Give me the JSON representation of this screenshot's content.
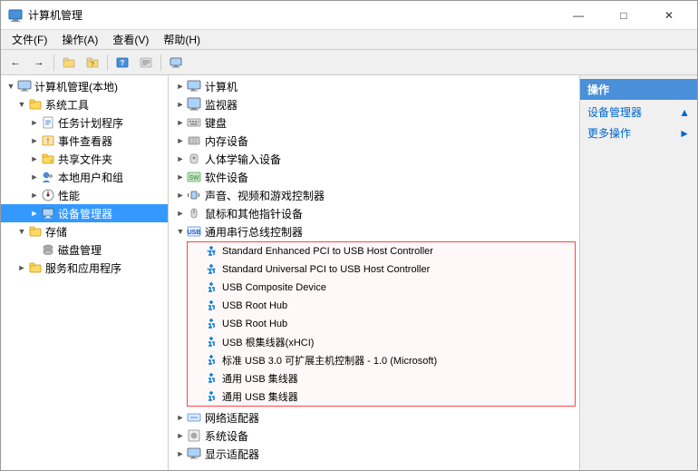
{
  "window": {
    "title": "计算机管理",
    "controls": {
      "minimize": "—",
      "maximize": "□",
      "close": "✕"
    }
  },
  "menubar": {
    "items": [
      "文件(F)",
      "操作(A)",
      "查看(V)",
      "帮助(H)"
    ]
  },
  "actions_panel": {
    "title": "操作",
    "items": [
      {
        "label": "设备管理器",
        "has_arrow": true
      },
      {
        "label": "更多操作",
        "has_arrow": true
      }
    ]
  },
  "tree": {
    "root_label": "计算机管理(本地)",
    "items": [
      {
        "label": "系统工具",
        "level": 1,
        "expanded": true,
        "type": "folder"
      },
      {
        "label": "任务计划程序",
        "level": 2,
        "type": "task"
      },
      {
        "label": "事件查看器",
        "level": 2,
        "type": "event"
      },
      {
        "label": "共享文件夹",
        "level": 2,
        "type": "folder"
      },
      {
        "label": "本地用户和组",
        "level": 2,
        "type": "users"
      },
      {
        "label": "性能",
        "level": 2,
        "type": "perf"
      },
      {
        "label": "设备管理器",
        "level": 2,
        "type": "device",
        "selected": true
      },
      {
        "label": "存储",
        "level": 1,
        "expanded": true,
        "type": "storage"
      },
      {
        "label": "磁盘管理",
        "level": 2,
        "type": "disk"
      },
      {
        "label": "服务和应用程序",
        "level": 1,
        "type": "services"
      }
    ]
  },
  "devices": {
    "items": [
      {
        "label": "计算机",
        "level": 0,
        "expanded": false,
        "type": "computer"
      },
      {
        "label": "监视器",
        "level": 0,
        "expanded": false,
        "type": "monitor"
      },
      {
        "label": "键盘",
        "level": 0,
        "expanded": false,
        "type": "keyboard"
      },
      {
        "label": "内存设备",
        "level": 0,
        "expanded": false,
        "type": "memory"
      },
      {
        "label": "人体学输入设备",
        "level": 0,
        "expanded": false,
        "type": "hid"
      },
      {
        "label": "软件设备",
        "level": 0,
        "expanded": false,
        "type": "software"
      },
      {
        "label": "声音、视频和游戏控制器",
        "level": 0,
        "expanded": false,
        "type": "audio"
      },
      {
        "label": "鼠标和其他指针设备",
        "level": 0,
        "expanded": false,
        "type": "mouse"
      },
      {
        "label": "通用串行总线控制器",
        "level": 0,
        "expanded": true,
        "type": "usb"
      },
      {
        "label": "Standard Enhanced PCI to USB Host Controller",
        "level": 1,
        "type": "usbdev",
        "highlighted": true
      },
      {
        "label": "Standard Universal PCI to USB Host Controller",
        "level": 1,
        "type": "usbdev",
        "highlighted": true
      },
      {
        "label": "USB Composite Device",
        "level": 1,
        "type": "usbdev",
        "highlighted": true
      },
      {
        "label": "USB Root Hub",
        "level": 1,
        "type": "usbdev",
        "highlighted": true
      },
      {
        "label": "USB Root Hub",
        "level": 1,
        "type": "usbdev",
        "highlighted": true
      },
      {
        "label": "USB 根集线器(xHCI)",
        "level": 1,
        "type": "usbdev",
        "highlighted": true
      },
      {
        "label": "标准 USB 3.0 可扩展主机控制器 - 1.0 (Microsoft)",
        "level": 1,
        "type": "usbdev",
        "highlighted": true
      },
      {
        "label": "通用 USB 集线器",
        "level": 1,
        "type": "usbdev",
        "highlighted": true
      },
      {
        "label": "通用 USB 集线器",
        "level": 1,
        "type": "usbdev",
        "highlighted": true
      },
      {
        "label": "网络适配器",
        "level": 0,
        "expanded": false,
        "type": "network"
      },
      {
        "label": "系统设备",
        "level": 0,
        "expanded": false,
        "type": "system"
      },
      {
        "label": "显示适配器",
        "level": 0,
        "expanded": false,
        "type": "display"
      }
    ]
  }
}
